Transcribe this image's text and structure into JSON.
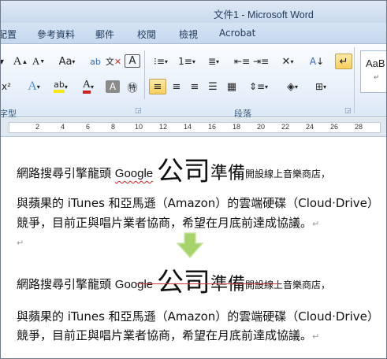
{
  "window": {
    "title": "文件1 - Microsoft Word"
  },
  "tabs": [
    "配置",
    "參考資料",
    "郵件",
    "校閱",
    "檢視",
    "Acrobat"
  ],
  "ribbon": {
    "group_font": "字型",
    "group_paragraph": "段落",
    "style_preview": "AaB",
    "style_sub": "↵"
  },
  "ruler": {
    "numbers": [
      "2",
      "4",
      "6",
      "8",
      "10",
      "12",
      "14",
      "16",
      "18",
      "20",
      "22",
      "24",
      "26",
      "28"
    ]
  },
  "document": {
    "before": {
      "line1_prefix": "網路搜尋引擎龍頭 ",
      "google": "Google",
      "big": "公司",
      "mid": "準備",
      "line1_suffix": "開設線上音樂商店，",
      "line2": "與蘋果的 iTunes 和亞馬遜（Amazon）的雲端硬碟（Cloud·Drive）",
      "line3": "競爭，目前正與唱片業者協商，希望在月底前達成協議。",
      "para_mark": "↵",
      "empty_mark": "↵"
    },
    "after": {
      "line1_prefix": "網路搜尋引擎龍頭 ",
      "google": "Google",
      "big": "公司",
      "mid": "準備",
      "line1_suffix": "開設線上音樂商店，",
      "line2": "與蘋果的 iTunes 和亞馬遜（Amazon）的雲端硬碟（Cloud·Drive）",
      "line3": "競爭，目前正與唱片業者協商，希望在月底前達成協議。",
      "para_mark": "↵"
    }
  },
  "colors": {
    "arrow": "#a6d36a",
    "strike": "#d23c3c",
    "highlight": "#f5e71a",
    "font_color": "#d01e1e"
  }
}
